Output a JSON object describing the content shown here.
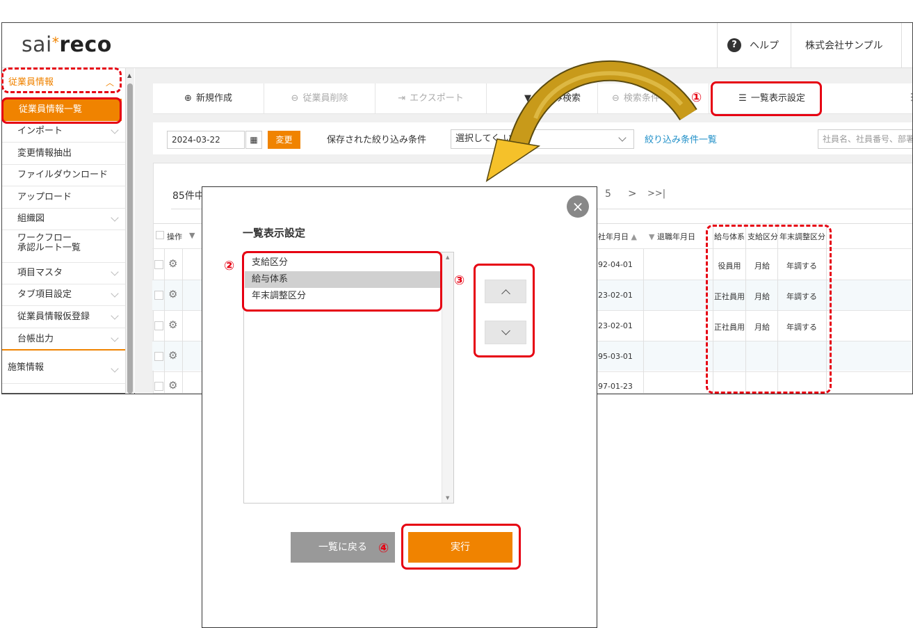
{
  "header": {
    "logo_light": "sai",
    "logo_star": "*",
    "logo_bold": "reco",
    "help_label": "ヘルプ",
    "help_icon": "?",
    "company": "株式会社サンプル"
  },
  "sidebar": {
    "section": "従業員情報",
    "active_item": "従業員情報一覧",
    "items": [
      {
        "label": "インポート"
      },
      {
        "label": "変更情報抽出"
      },
      {
        "label": "ファイルダウンロード"
      },
      {
        "label": "アップロード"
      },
      {
        "label": "組織図"
      },
      {
        "label": "ワークフロー",
        "label2": "承認ルート一覧"
      },
      {
        "label": "項目マスタ"
      },
      {
        "label": "タブ項目設定"
      },
      {
        "label": "従業員情報仮登録"
      },
      {
        "label": "台帳出力"
      }
    ],
    "section2": "施策情報"
  },
  "toolbar": {
    "new_label": "新規作成",
    "delete_label": "従業員削除",
    "export_label": "エクスポート",
    "filter_label": "り込み検索",
    "clear_label": "検索条件",
    "display_settings_label": "一覧表示設定"
  },
  "filterbar": {
    "date": "2024-03-22",
    "change_label": "変更",
    "saved_label": "保存された絞り込み条件",
    "saved_select": "選択してく     い",
    "filter_list_link": "絞り込み条件一覧",
    "search_placeholder": "社員名、社員番号、部署"
  },
  "list": {
    "count": "85件中",
    "page5": "5",
    "next": ">",
    "last": ">>|",
    "headers": {
      "ops": "操作",
      "join_date": "社年月日",
      "retire_date": "退職年月日",
      "pay_system": "給与体系",
      "pay_type": "支給区分",
      "year_end": "年末調整区分"
    },
    "rows": [
      {
        "date": "92-04-01",
        "pay_system": "役員用",
        "pay_type": "月給",
        "year_end": "年調する"
      },
      {
        "date": "23-02-01",
        "pay_system": "正社員用",
        "pay_type": "月給",
        "year_end": "年調する"
      },
      {
        "date": "23-02-01",
        "pay_system": "正社員用",
        "pay_type": "月給",
        "year_end": "年調する"
      },
      {
        "date": "95-03-01",
        "pay_system": "",
        "pay_type": "",
        "year_end": ""
      },
      {
        "date": "97-01-23",
        "pay_system": "",
        "pay_type": "",
        "year_end": ""
      }
    ]
  },
  "modal": {
    "title": "一覧表示設定",
    "items": [
      "支給区分",
      "給与体系",
      "年末調整区分"
    ],
    "selected_index": 1,
    "back_label": "一覧に戻る",
    "run_label": "実行",
    "close_icon": "×"
  },
  "annotations": {
    "n1": "①",
    "n2": "②",
    "n3": "③",
    "n4": "④"
  },
  "colors": {
    "accent": "#f08300",
    "annotation": "#e60012",
    "arrow": "#c89a1a"
  }
}
